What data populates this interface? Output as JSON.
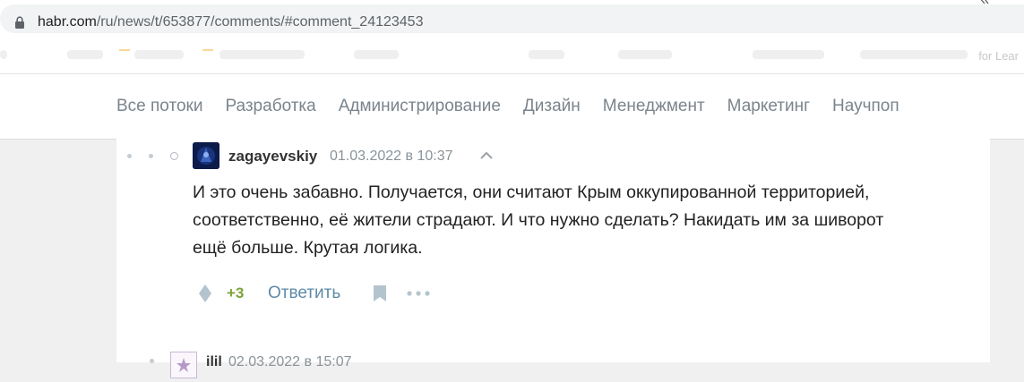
{
  "browser": {
    "url_host": "habr.com",
    "url_path": "/ru/news/t/653877/comments/#comment_24123453",
    "bookmarks_trailing_text": "for Lear"
  },
  "nav": {
    "items": [
      {
        "label": "Все потоки"
      },
      {
        "label": "Разработка"
      },
      {
        "label": "Администрирование"
      },
      {
        "label": "Дизайн"
      },
      {
        "label": "Менеджмент"
      },
      {
        "label": "Маркетинг"
      },
      {
        "label": "Научпоп"
      }
    ]
  },
  "comment": {
    "username": "zagayevskiy",
    "timestamp": "01.03.2022 в 10:37",
    "lines": [
      "И это очень забавно. Получается, они считают Крым оккупированной территорией,",
      "соответственно, её жители страдают. И что нужно сделать? Накидать им за шиворот",
      "ещё больше. Крутая логика."
    ],
    "score": "+3",
    "reply_label": "Ответить"
  },
  "next_comment": {
    "username": "ilil",
    "timestamp": "02.03.2022 в 15:07"
  },
  "colors": {
    "nav_text": "#7b848c",
    "score": "#7ba33a",
    "reply_link": "#5e8aa8",
    "page_bg": "#f0f0f0"
  }
}
